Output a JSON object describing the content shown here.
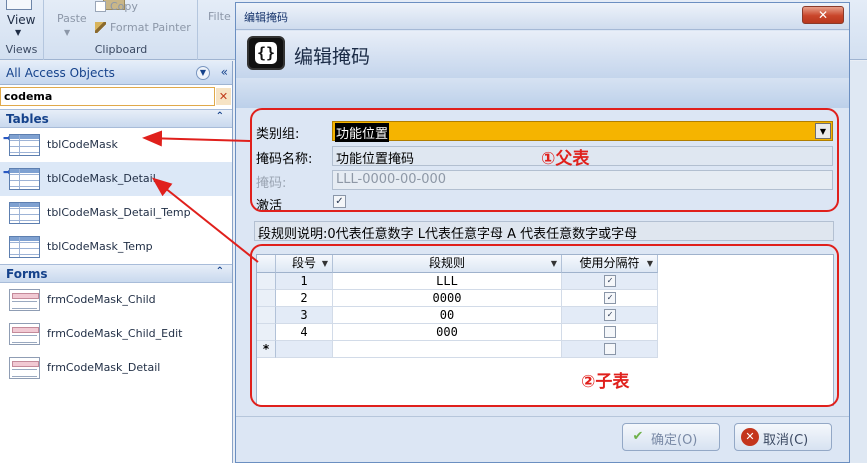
{
  "ribbon": {
    "view_label": "View",
    "views_group": "Views",
    "paste_label": "Paste",
    "copy_label": "Copy",
    "format_painter_label": "Format Painter",
    "clipboard_group": "Clipboard",
    "filter_label": "Filte"
  },
  "nav": {
    "header": "All Access Objects",
    "search_value": "codema",
    "tables_section": "Tables",
    "tables": [
      "tblCodeMask",
      "tblCodeMask_Detail",
      "tblCodeMask_Detail_Temp",
      "tblCodeMask_Temp"
    ],
    "forms_section": "Forms",
    "forms": [
      "frmCodeMask_Child",
      "frmCodeMask_Child_Edit",
      "frmCodeMask_Detail"
    ]
  },
  "dialog": {
    "window_title": "编辑掩码",
    "heading": "编辑掩码",
    "close_label": "✕",
    "category_label": "类别组:",
    "category_value": "功能位置",
    "mask_name_label": "掩码名称:",
    "mask_name_value": "功能位置掩码",
    "mask_label": "掩码:",
    "mask_value": "LLL-0000-00-000",
    "active_label": "激活",
    "active_checked": true,
    "rule_note": "段规则说明:0代表任意数字 L代表任意字母 A 代表任意数字或字母",
    "grid": {
      "columns": [
        "段号",
        "段规则",
        "使用分隔符"
      ],
      "rows": [
        {
          "no": "1",
          "rule": "LLL",
          "sep": true
        },
        {
          "no": "2",
          "rule": "0000",
          "sep": true
        },
        {
          "no": "3",
          "rule": "00",
          "sep": true
        },
        {
          "no": "4",
          "rule": "000",
          "sep": false
        }
      ],
      "new_row_marker": "*"
    },
    "ok_label": "确定(O)",
    "cancel_label": "取消(C)"
  },
  "annotations": {
    "parent": "①父表",
    "child": "②子表",
    "color": "#e0201c"
  }
}
